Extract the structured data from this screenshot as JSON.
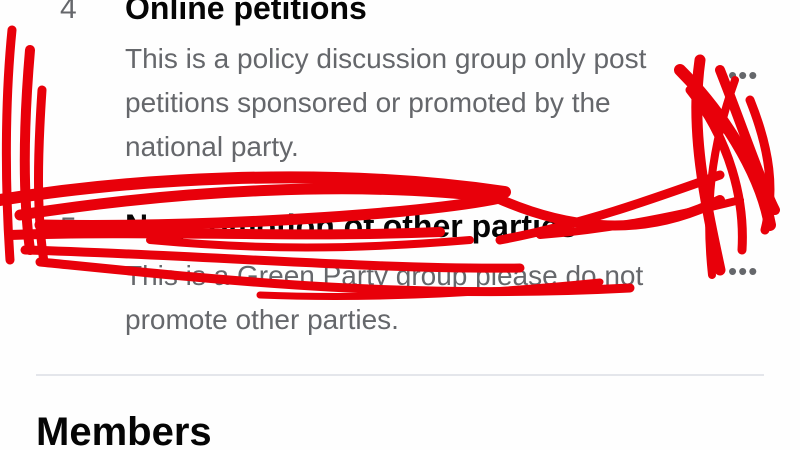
{
  "rules": [
    {
      "number": "4",
      "title": "Online petitions",
      "description": "This is a policy discussion group only post petitions sponsored or promoted by the national party.",
      "more_icon": "more-horizontal-icon"
    },
    {
      "number": "5",
      "title": "No promotion of other parties",
      "description": "This is a Green Party group please do not promote other parties.",
      "more_icon": "more-horizontal-icon"
    }
  ],
  "members_section": {
    "title": "Members"
  },
  "overlay": {
    "scribble_color": "#e8000a",
    "scribble_icon": "red-marker-scribble"
  }
}
